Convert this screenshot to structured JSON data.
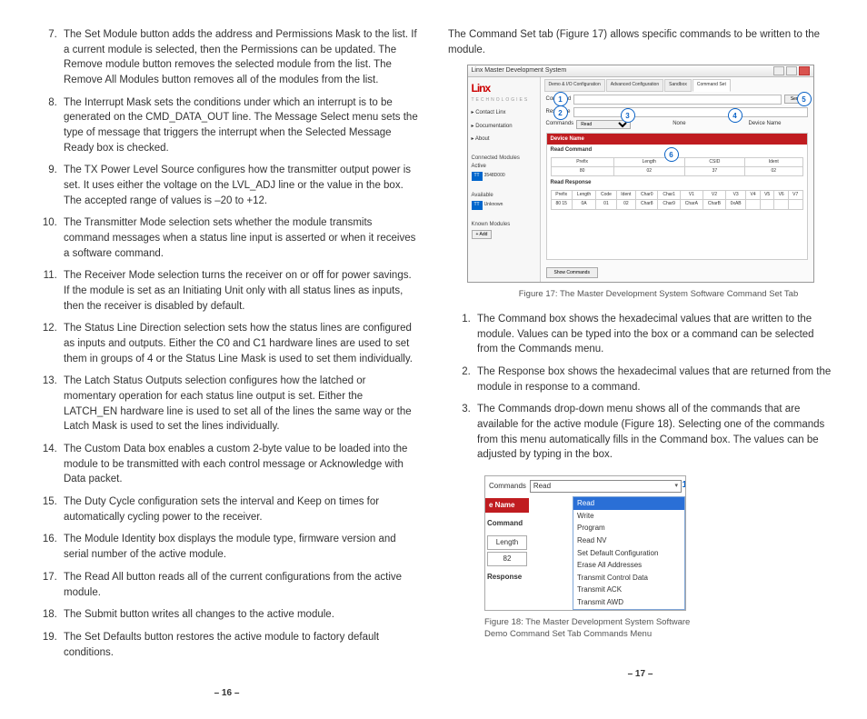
{
  "left": {
    "start": 7,
    "items": [
      "The Set Module button adds the address and Permissions Mask to the list. If a current module is selected, then the Permissions can be updated. The Remove module button removes the selected module from the list. The Remove All Modules button removes all of the modules from the list.",
      "The Interrupt Mask sets the conditions under which an interrupt is to be generated on the CMD_DATA_OUT line. The Message Select menu sets the type of message that triggers the interrupt when the Selected Message Ready box is checked.",
      "The TX Power Level Source configures how the transmitter output power is set. It uses either the voltage on the LVL_ADJ line or the value in the box. The accepted range of values is –20 to +12.",
      "The Transmitter Mode selection sets whether the module transmits command messages when a status line input is asserted or when it receives a software command.",
      "The Receiver Mode selection turns the receiver on or off for power savings. If the module is set as an Initiating Unit only with all status lines as inputs, then the receiver is disabled by default.",
      "The Status Line Direction selection sets how the status lines are configured as inputs and outputs. Either the C0 and C1 hardware lines are used to set them in groups of 4 or the Status Line Mask is used to set them individually.",
      "The Latch Status Outputs selection configures how the latched or momentary operation for each status line output is set. Either the LATCH_EN hardware line is used to set all of the lines the same way or the Latch Mask is used to set the lines individually.",
      "The Custom Data box enables a custom 2-byte value to be loaded into the module to be transmitted with each control message or Acknowledge with Data packet.",
      "The Duty Cycle configuration sets the interval and Keep on times for automatically cycling power to the receiver.",
      "The Module Identity box displays the module type, firmware version and serial number of the active module.",
      "The Read All button reads all of the current configurations from the active module.",
      "The Submit button writes all changes to the active module.",
      "The Set Defaults button restores the active module to factory default conditions."
    ],
    "pagenum": "– 16 –"
  },
  "right": {
    "intro": "The Command Set tab (Figure 17) allows specific commands to be written to the module.",
    "fig17": {
      "title": "Linx Master Development System",
      "logo": "Linx",
      "logo_sub": "TECHNOLOGIES",
      "sidebar": {
        "items": [
          "Contact Linx",
          "Documentation",
          "About"
        ],
        "connected": "Connected Modules",
        "active": "Active",
        "active_tag": "TT",
        "active_val": "3548D000",
        "available": "Available",
        "avail_tag": "TT",
        "avail_val": "Unknown",
        "known": "Known Modules",
        "known_btn": "+ Add"
      },
      "tabs": [
        "Demo & I/O Configuration",
        "Advanced Configuration",
        "Sandbox",
        "Command Set"
      ],
      "cmd": {
        "label": "Command",
        "send": "Send"
      },
      "drops": {
        "label": "Commands",
        "sel": "Read",
        "none": "None",
        "dn": "Device Name"
      },
      "panel_h": "Device Name",
      "readcmd": "Read Command",
      "readresp": "Read Response",
      "t1": {
        "h": [
          "Prefix",
          "Length",
          "CSID",
          "Ident"
        ],
        "r": [
          "80",
          "02",
          "37",
          "02"
        ]
      },
      "t2": {
        "h": [
          "Prefix",
          "Length",
          "Code",
          "Ident",
          "Char0",
          "Char1",
          "V1",
          "V2",
          "V3",
          "V4",
          "V5",
          "V6",
          "V7"
        ],
        "r": [
          "80 15",
          "0A",
          "01",
          "02",
          "Char8",
          "Char9",
          "CharA",
          "CharB",
          "0xAB",
          "",
          "",
          "",
          ""
        ]
      },
      "showcmd": "Show Commands",
      "callouts": [
        "1",
        "2",
        "3",
        "4",
        "5",
        "6"
      ],
      "caption": "Figure 17: The Master Development System Software Command Set Tab"
    },
    "list": {
      "items": [
        "The Command box shows the hexadecimal values that are written to the module. Values can be typed into the box or a command can be selected from the Commands menu.",
        "The Response box shows the hexadecimal values that are returned from the module in response to a command.",
        "The Commands drop-down menu shows all of the commands that are available for the active module (Figure 18). Selecting one of the commands from this menu automatically fills in the Command box. The values can be adjusted by typing in the box."
      ]
    },
    "fig18": {
      "cmdlabel": "Commands",
      "selected": "Read",
      "options": [
        "Read",
        "Write",
        "Program",
        "Read NV",
        "Set Default Configuration",
        "Erase All Addresses",
        "Transmit Control Data",
        "Transmit ACK",
        "Transmit AWD"
      ],
      "strip": "e Name",
      "commandlbl": "Command",
      "lengthlbl": "Length",
      "lengthval": "82",
      "response": "Response",
      "caption": "Figure 18: The Master Development System Software\nDemo Command Set Tab Commands Menu"
    },
    "pagenum": "– 17 –"
  }
}
